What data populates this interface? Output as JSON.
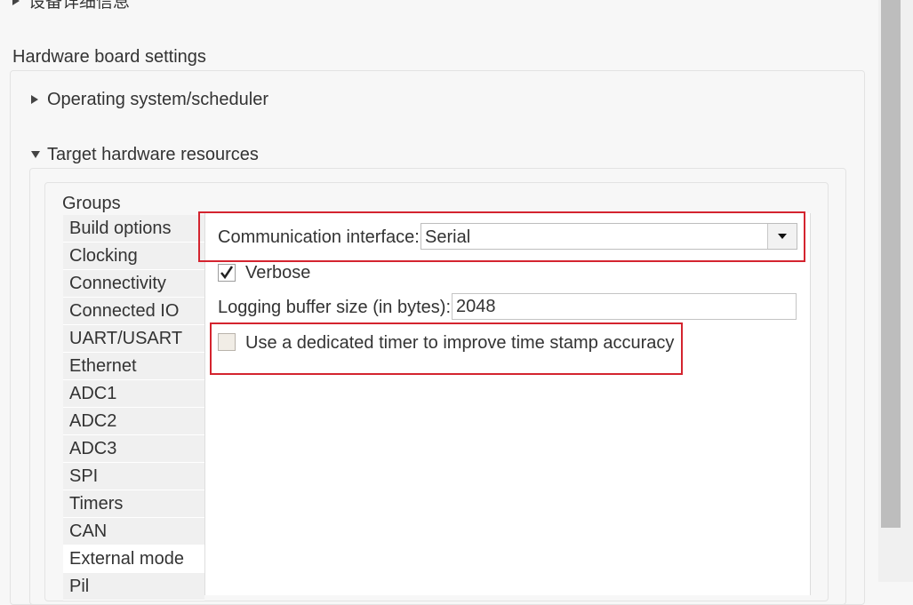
{
  "top_section": {
    "label": "设备详细信息"
  },
  "hardware_board_settings": {
    "title": "Hardware board settings"
  },
  "sections": {
    "os_scheduler": "Operating system/scheduler",
    "target_hw": "Target hardware resources"
  },
  "groups": {
    "title": "Groups",
    "items": [
      "Build options",
      "Clocking",
      "Connectivity",
      "Connected IO",
      "UART/USART",
      "Ethernet",
      "ADC1",
      "ADC2",
      "ADC3",
      "SPI",
      "Timers",
      "CAN",
      "External mode",
      "Pil"
    ],
    "selected": "External mode"
  },
  "external_mode": {
    "comm_label": "Communication interface:",
    "comm_value": "Serial",
    "verbose_label": "Verbose",
    "verbose_checked": true,
    "logging_label": "Logging buffer size (in bytes):",
    "logging_value": "2048",
    "timer_label": "Use a dedicated timer to improve time stamp accuracy",
    "timer_checked": false
  },
  "icons": {
    "expand_collapsed": "triangle-right-icon",
    "expand_open": "triangle-down-icon",
    "dropdown": "chevron-down-icon",
    "check": "checkmark-icon"
  },
  "colors": {
    "highlight_border": "#d4242f",
    "background": "#f7f7f7",
    "selected_group": "#ffffff"
  }
}
